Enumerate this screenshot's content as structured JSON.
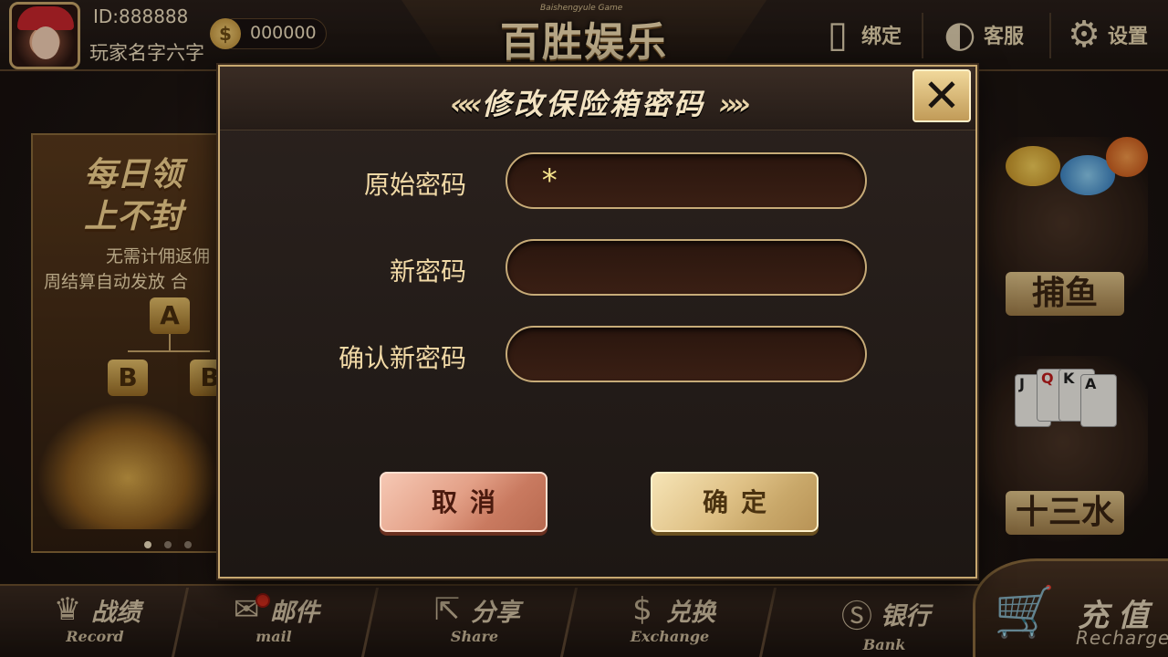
{
  "header": {
    "user_id": "ID:888888",
    "user_name": "玩家名字六字",
    "coins": "000000",
    "coin_symbol": "$",
    "logo_title": "百胜娱乐",
    "logo_subtitle": "Baishengyule Game",
    "actions": [
      {
        "label": "绑定",
        "icon": "phone-link-icon"
      },
      {
        "label": "客服",
        "icon": "headset-icon"
      },
      {
        "label": "设置",
        "icon": "gear-icon"
      }
    ]
  },
  "promo": {
    "line1": "每日领",
    "line2": "上不封",
    "text1": "无需计佣返佣",
    "text2": "周结算自动发放 合",
    "node_a": "A",
    "node_b1": "B",
    "node_b2": "B"
  },
  "games": [
    {
      "title": "捕鱼"
    },
    {
      "title": "十三水"
    }
  ],
  "cards": [
    "J",
    "Q",
    "K",
    "A"
  ],
  "bottom_nav": [
    {
      "label": "战绩",
      "sub": "Record",
      "icon": "trophy-icon"
    },
    {
      "label": "邮件",
      "sub": "mail",
      "icon": "envelope-icon"
    },
    {
      "label": "分享",
      "sub": "Share",
      "icon": "share-icon"
    },
    {
      "label": "兑换",
      "sub": "Exchange",
      "icon": "dollar-icon"
    },
    {
      "label": "银行",
      "sub": "Bank",
      "icon": "bank-coin-icon"
    }
  ],
  "recharge": {
    "label": "充值",
    "sub": "Recharge"
  },
  "dialog": {
    "title": "修改保险箱密码",
    "close_symbol": "✕",
    "fields": [
      {
        "label": "原始密码",
        "value": "*"
      },
      {
        "label": "新密码",
        "value": ""
      },
      {
        "label": "确认新密码",
        "value": ""
      }
    ],
    "cancel_label": "取消",
    "confirm_label": "确定"
  }
}
